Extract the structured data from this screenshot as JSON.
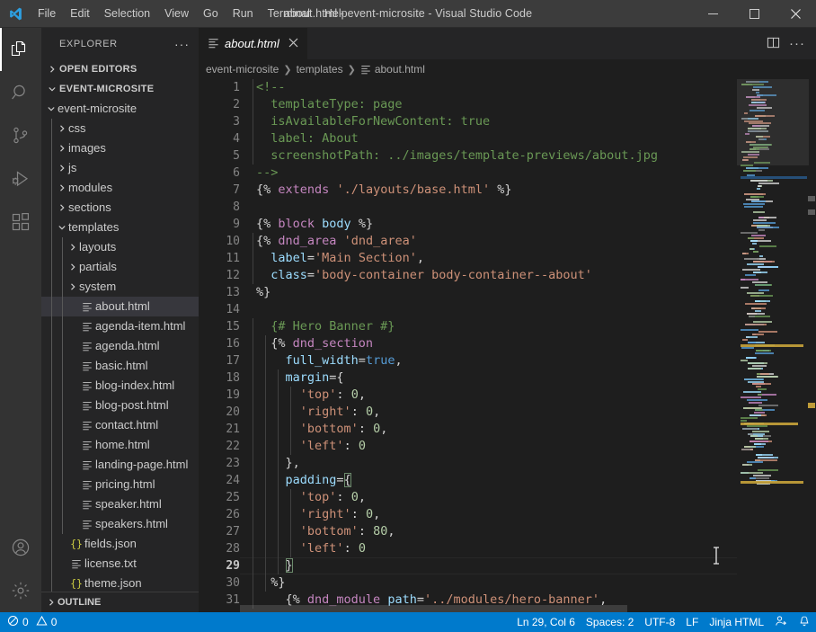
{
  "titlebar": {
    "logo_icon": "vscode-logo-icon",
    "window_title": "about.html - event-microsite - Visual Studio Code",
    "menus": [
      "File",
      "Edit",
      "Selection",
      "View",
      "Go",
      "Run",
      "Terminal",
      "Help"
    ],
    "minimize_icon": "minimize-icon",
    "maximize_icon": "maximize-icon",
    "close_icon": "close-icon"
  },
  "activitybar": {
    "items": [
      {
        "name": "explorer",
        "icon": "files-icon",
        "active": true
      },
      {
        "name": "search",
        "icon": "search-icon",
        "active": false
      },
      {
        "name": "source-control",
        "icon": "source-control-icon",
        "active": false
      },
      {
        "name": "run-and-debug",
        "icon": "run-debug-icon",
        "active": false
      },
      {
        "name": "extensions",
        "icon": "extensions-icon",
        "active": false
      }
    ],
    "bottom": [
      {
        "name": "accounts",
        "icon": "account-icon"
      },
      {
        "name": "manage",
        "icon": "gear-icon"
      }
    ]
  },
  "sidebar": {
    "title": "EXPLORER",
    "more_actions_icon": "ellipsis-icon",
    "open_editors": {
      "label": "OPEN EDITORS",
      "expanded": false
    },
    "workspace": {
      "label": "EVENT-MICROSITE",
      "expanded": true
    },
    "outline": {
      "label": "OUTLINE",
      "expanded": false
    },
    "tree": [
      {
        "label": "event-microsite",
        "type": "folder",
        "depth": 1,
        "expanded": true
      },
      {
        "label": "css",
        "type": "folder",
        "depth": 2,
        "expanded": false
      },
      {
        "label": "images",
        "type": "folder",
        "depth": 2,
        "expanded": false
      },
      {
        "label": "js",
        "type": "folder",
        "depth": 2,
        "expanded": false
      },
      {
        "label": "modules",
        "type": "folder",
        "depth": 2,
        "expanded": false
      },
      {
        "label": "sections",
        "type": "folder",
        "depth": 2,
        "expanded": false
      },
      {
        "label": "templates",
        "type": "folder",
        "depth": 2,
        "expanded": true
      },
      {
        "label": "layouts",
        "type": "folder",
        "depth": 3,
        "expanded": false
      },
      {
        "label": "partials",
        "type": "folder",
        "depth": 3,
        "expanded": false
      },
      {
        "label": "system",
        "type": "folder",
        "depth": 3,
        "expanded": false
      },
      {
        "label": "about.html",
        "type": "html",
        "depth": 3,
        "selected": true
      },
      {
        "label": "agenda-item.html",
        "type": "html",
        "depth": 3
      },
      {
        "label": "agenda.html",
        "type": "html",
        "depth": 3
      },
      {
        "label": "basic.html",
        "type": "html",
        "depth": 3
      },
      {
        "label": "blog-index.html",
        "type": "html",
        "depth": 3
      },
      {
        "label": "blog-post.html",
        "type": "html",
        "depth": 3
      },
      {
        "label": "contact.html",
        "type": "html",
        "depth": 3
      },
      {
        "label": "home.html",
        "type": "html",
        "depth": 3
      },
      {
        "label": "landing-page.html",
        "type": "html",
        "depth": 3
      },
      {
        "label": "pricing.html",
        "type": "html",
        "depth": 3
      },
      {
        "label": "speaker.html",
        "type": "html",
        "depth": 3
      },
      {
        "label": "speakers.html",
        "type": "html",
        "depth": 3
      },
      {
        "label": "fields.json",
        "type": "json",
        "depth": 2
      },
      {
        "label": "license.txt",
        "type": "html",
        "depth": 2
      },
      {
        "label": "theme.json",
        "type": "json",
        "depth": 2
      }
    ]
  },
  "editor": {
    "tab": {
      "icon": "html-file-icon",
      "label": "about.html",
      "close_icon": "close-icon",
      "dirty": false
    },
    "actions": [
      {
        "name": "split-editor",
        "icon": "split-editor-icon"
      },
      {
        "name": "more-actions",
        "icon": "ellipsis-icon"
      }
    ],
    "breadcrumb": [
      "event-microsite",
      "templates",
      "about.html"
    ],
    "breadcrumb_file_icon": "html-file-icon",
    "active_line": 29,
    "lines": [
      {
        "n": 1,
        "tokens": [
          [
            "c-comment",
            "<!--"
          ]
        ]
      },
      {
        "n": 2,
        "tokens": [
          [
            "c-comment",
            "  templateType: page"
          ]
        ]
      },
      {
        "n": 3,
        "tokens": [
          [
            "c-comment",
            "  isAvailableForNewContent: true"
          ]
        ]
      },
      {
        "n": 4,
        "tokens": [
          [
            "c-comment",
            "  label: About"
          ]
        ]
      },
      {
        "n": 5,
        "tokens": [
          [
            "c-comment",
            "  screenshotPath: ../images/template-previews/about.jpg"
          ]
        ]
      },
      {
        "n": 6,
        "tokens": [
          [
            "c-comment",
            "-->"
          ]
        ]
      },
      {
        "n": 7,
        "tokens": [
          [
            "c-plain",
            "{% "
          ],
          [
            "c-kw",
            "extends"
          ],
          [
            "c-plain",
            " "
          ],
          [
            "c-str",
            "'./layouts/base.html'"
          ],
          [
            "c-plain",
            " %}"
          ]
        ]
      },
      {
        "n": 8,
        "tokens": []
      },
      {
        "n": 9,
        "tokens": [
          [
            "c-plain",
            "{% "
          ],
          [
            "c-kw",
            "block"
          ],
          [
            "c-plain",
            " "
          ],
          [
            "c-attr",
            "body"
          ],
          [
            "c-plain",
            " %}"
          ]
        ]
      },
      {
        "n": 10,
        "tokens": [
          [
            "c-plain",
            "{% "
          ],
          [
            "c-kw",
            "dnd_area"
          ],
          [
            "c-plain",
            " "
          ],
          [
            "c-str",
            "'dnd_area'"
          ]
        ]
      },
      {
        "n": 11,
        "tokens": [
          [
            "c-plain",
            "  "
          ],
          [
            "c-attr",
            "label"
          ],
          [
            "c-plain",
            "="
          ],
          [
            "c-str",
            "'Main Section'"
          ],
          [
            "c-plain",
            ","
          ]
        ]
      },
      {
        "n": 12,
        "tokens": [
          [
            "c-plain",
            "  "
          ],
          [
            "c-attr",
            "class"
          ],
          [
            "c-plain",
            "="
          ],
          [
            "c-str",
            "'body-container body-container--about'"
          ]
        ]
      },
      {
        "n": 13,
        "tokens": [
          [
            "c-plain",
            "%}"
          ]
        ]
      },
      {
        "n": 14,
        "tokens": []
      },
      {
        "n": 15,
        "tokens": [
          [
            "c-plain",
            "  "
          ],
          [
            "c-comment",
            "{# Hero Banner #}"
          ]
        ]
      },
      {
        "n": 16,
        "tokens": [
          [
            "c-plain",
            "  {% "
          ],
          [
            "c-kw",
            "dnd_section"
          ]
        ]
      },
      {
        "n": 17,
        "tokens": [
          [
            "c-plain",
            "    "
          ],
          [
            "c-attr",
            "full_width"
          ],
          [
            "c-plain",
            "="
          ],
          [
            "c-blue",
            "true"
          ],
          [
            "c-plain",
            ","
          ]
        ]
      },
      {
        "n": 18,
        "tokens": [
          [
            "c-plain",
            "    "
          ],
          [
            "c-attr",
            "margin"
          ],
          [
            "c-plain",
            "={"
          ]
        ]
      },
      {
        "n": 19,
        "tokens": [
          [
            "c-plain",
            "      "
          ],
          [
            "c-str",
            "'top'"
          ],
          [
            "c-plain",
            ": "
          ],
          [
            "c-num",
            "0"
          ],
          [
            "c-plain",
            ","
          ]
        ]
      },
      {
        "n": 20,
        "tokens": [
          [
            "c-plain",
            "      "
          ],
          [
            "c-str",
            "'right'"
          ],
          [
            "c-plain",
            ": "
          ],
          [
            "c-num",
            "0"
          ],
          [
            "c-plain",
            ","
          ]
        ]
      },
      {
        "n": 21,
        "tokens": [
          [
            "c-plain",
            "      "
          ],
          [
            "c-str",
            "'bottom'"
          ],
          [
            "c-plain",
            ": "
          ],
          [
            "c-num",
            "0"
          ],
          [
            "c-plain",
            ","
          ]
        ]
      },
      {
        "n": 22,
        "tokens": [
          [
            "c-plain",
            "      "
          ],
          [
            "c-str",
            "'left'"
          ],
          [
            "c-plain",
            ": "
          ],
          [
            "c-num",
            "0"
          ]
        ]
      },
      {
        "n": 23,
        "tokens": [
          [
            "c-plain",
            "    },"
          ]
        ]
      },
      {
        "n": 24,
        "tokens": [
          [
            "c-plain",
            "    "
          ],
          [
            "c-attr",
            "padding"
          ],
          [
            "c-plain",
            "="
          ],
          [
            "c-plain bracket-match",
            "{"
          ]
        ]
      },
      {
        "n": 25,
        "tokens": [
          [
            "c-plain",
            "      "
          ],
          [
            "c-str",
            "'top'"
          ],
          [
            "c-plain",
            ": "
          ],
          [
            "c-num",
            "0"
          ],
          [
            "c-plain",
            ","
          ]
        ]
      },
      {
        "n": 26,
        "tokens": [
          [
            "c-plain",
            "      "
          ],
          [
            "c-str",
            "'right'"
          ],
          [
            "c-plain",
            ": "
          ],
          [
            "c-num",
            "0"
          ],
          [
            "c-plain",
            ","
          ]
        ]
      },
      {
        "n": 27,
        "tokens": [
          [
            "c-plain",
            "      "
          ],
          [
            "c-str",
            "'bottom'"
          ],
          [
            "c-plain",
            ": "
          ],
          [
            "c-num",
            "80"
          ],
          [
            "c-plain",
            ","
          ]
        ]
      },
      {
        "n": 28,
        "tokens": [
          [
            "c-plain",
            "      "
          ],
          [
            "c-str",
            "'left'"
          ],
          [
            "c-plain",
            ": "
          ],
          [
            "c-num",
            "0"
          ]
        ]
      },
      {
        "n": 29,
        "tokens": [
          [
            "c-plain",
            "    "
          ],
          [
            "c-plain bracket-match",
            "}"
          ]
        ]
      },
      {
        "n": 30,
        "tokens": [
          [
            "c-plain",
            "  %}"
          ]
        ]
      },
      {
        "n": 31,
        "tokens": [
          [
            "c-plain",
            "    {% "
          ],
          [
            "c-kw",
            "dnd_module"
          ],
          [
            "c-plain",
            " "
          ],
          [
            "c-attr",
            "path"
          ],
          [
            "c-plain",
            "="
          ],
          [
            "c-str",
            "'../modules/hero-banner'"
          ],
          [
            "c-plain",
            ","
          ]
        ]
      }
    ]
  },
  "statusbar": {
    "errors_icon": "error-icon",
    "errors": "0",
    "warnings_icon": "warning-icon",
    "warnings": "0",
    "cursor_position": "Ln 29, Col 6",
    "indentation": "Spaces: 2",
    "encoding": "UTF-8",
    "eol": "LF",
    "language_mode": "Jinja HTML",
    "feedback_icon": "feedback-icon",
    "notifications_icon": "bell-icon",
    "accent_color": "#007acc"
  }
}
